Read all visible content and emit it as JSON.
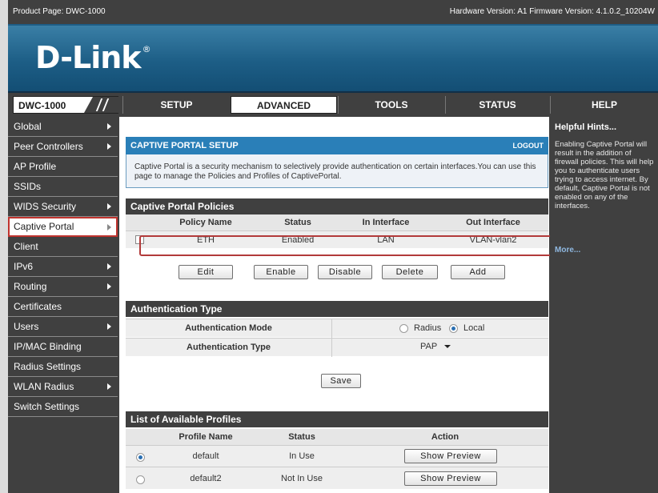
{
  "topbar": {
    "product_page": "Product Page: DWC-1000",
    "versions": "Hardware Version: A1   Firmware Version: 4.1.0.2_10204W"
  },
  "brand": {
    "logo_text": "D-Link",
    "reg_mark": "®"
  },
  "model": "DWC-1000",
  "nav_tabs": [
    {
      "label": "SETUP",
      "active": false
    },
    {
      "label": "ADVANCED",
      "active": true
    },
    {
      "label": "TOOLS",
      "active": false
    },
    {
      "label": "STATUS",
      "active": false
    },
    {
      "label": "HELP",
      "active": false
    }
  ],
  "sidebar": {
    "items": [
      {
        "label": "Global",
        "arrow": true
      },
      {
        "label": "Peer Controllers",
        "arrow": true
      },
      {
        "label": "AP Profile",
        "arrow": false
      },
      {
        "label": "SSIDs",
        "arrow": false
      },
      {
        "label": "WIDS Security",
        "arrow": true
      },
      {
        "label": "Captive Portal",
        "arrow": true,
        "active": true
      },
      {
        "label": "Client",
        "arrow": false
      },
      {
        "label": "IPv6",
        "arrow": true
      },
      {
        "label": "Routing",
        "arrow": true
      },
      {
        "label": "Certificates",
        "arrow": false
      },
      {
        "label": "Users",
        "arrow": true
      },
      {
        "label": "IP/MAC Binding",
        "arrow": false
      },
      {
        "label": "Radius Settings",
        "arrow": false
      },
      {
        "label": "WLAN Radius",
        "arrow": true
      },
      {
        "label": "Switch Settings",
        "arrow": false
      }
    ]
  },
  "page": {
    "title": "CAPTIVE PORTAL SETUP",
    "logout": "LOGOUT",
    "intro": "Captive Portal is a security mechanism to selectively provide authentication on certain interfaces.You can use this page to manage the Policies and Profiles of CaptivePortal."
  },
  "policies": {
    "title": "Captive Portal Policies",
    "columns": [
      "Policy Name",
      "Status",
      "In Interface",
      "Out Interface"
    ],
    "rows": [
      {
        "name": "ETH",
        "status": "Enabled",
        "in": "LAN",
        "out": "VLAN-vlan2",
        "checked": false
      }
    ],
    "buttons": {
      "edit": "Edit",
      "enable": "Enable",
      "disable": "Disable",
      "delete": "Delete",
      "add": "Add"
    }
  },
  "auth": {
    "title": "Authentication Type",
    "mode_label": "Authentication Mode",
    "mode_options": {
      "radius": "Radius",
      "local": "Local"
    },
    "mode_selected": "Local",
    "type_label": "Authentication Type",
    "type_value": "PAP",
    "save": "Save"
  },
  "profiles": {
    "title": "List of Available Profiles",
    "columns": [
      "Profile Name",
      "Status",
      "Action"
    ],
    "rows": [
      {
        "name": "default",
        "status": "In Use",
        "action": "Show Preview",
        "selected": true
      },
      {
        "name": "default2",
        "status": "Not In Use",
        "action": "Show Preview",
        "selected": false
      }
    ]
  },
  "help": {
    "title": "Helpful Hints...",
    "body": "Enabling Captive Portal will result in the addition of firewall policies. This will help you to authenticate users trying to access internet. By default, Captive Portal is not enabled on any of the interfaces.",
    "more": "More..."
  },
  "colors": {
    "accent": "#2a7fb8",
    "frame": "#404040",
    "highlight": "#b23a3a"
  }
}
